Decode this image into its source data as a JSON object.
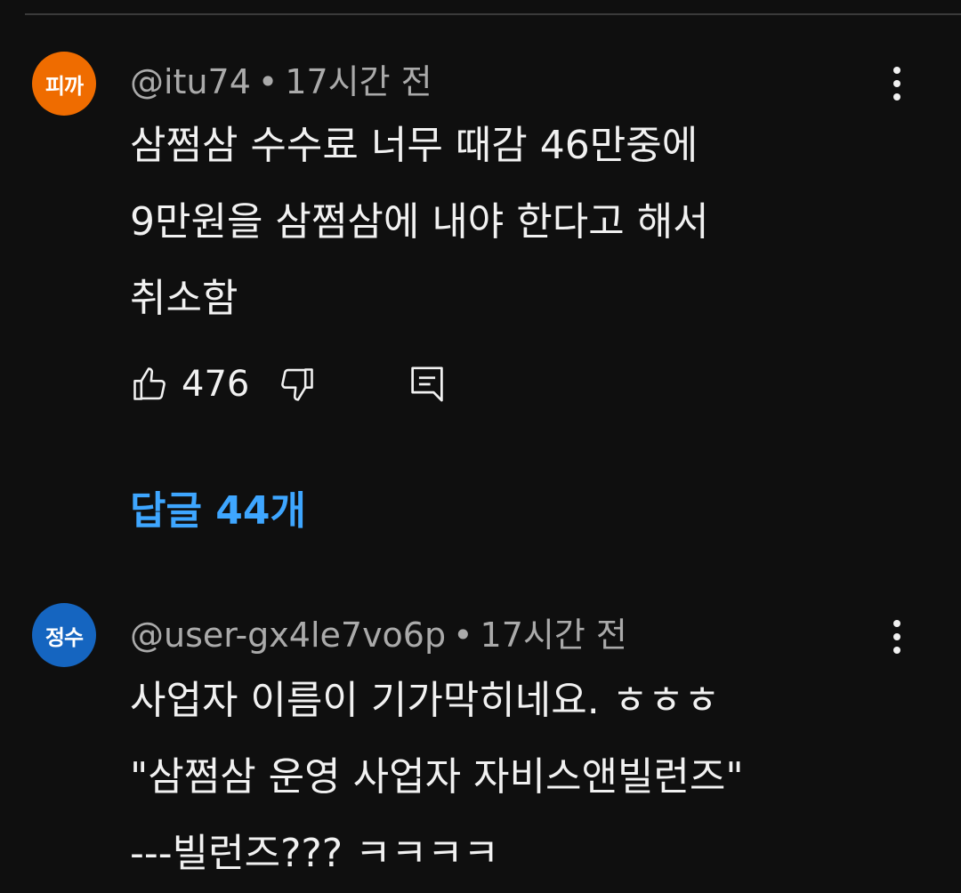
{
  "comments": [
    {
      "avatar_text": "피까",
      "avatar_color": "#ef6c00",
      "author": "@itu74",
      "separator": "•",
      "time": "17시간 전",
      "lines": [
        "삼쩜삼 수수료 너무 때감  46만중에",
        "9만원을 삼쩜삼에 내야 한다고 해서",
        "취소함"
      ],
      "likes": "476",
      "replies_label": "답글 44개",
      "icons": [
        "thumbs-up-icon",
        "thumbs-down-icon",
        "reply-icon",
        "more-vert-icon"
      ]
    },
    {
      "avatar_text": "정수",
      "avatar_color": "#1565c0",
      "author": "@user-gx4le7vo6p",
      "separator": "•",
      "time": "17시간 전",
      "lines": [
        "사업자 이름이 기가막히네요. ㅎㅎㅎ",
        "\"삼쩜삼 운영 사업자 자비스앤빌런즈\"",
        "---빌런즈??? ㅋㅋㅋㅋ"
      ],
      "icons": [
        "more-vert-icon"
      ]
    }
  ],
  "colors": {
    "background": "#0f0f0f",
    "text": "#f1f1f1",
    "meta": "#aaaaaa",
    "link": "#3ea6ff"
  }
}
